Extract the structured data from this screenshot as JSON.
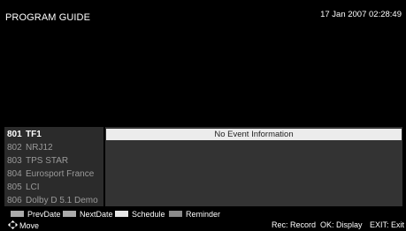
{
  "header": {
    "title": "PROGRAM GUIDE",
    "datetime": "17 Jan 2007 02:28:49"
  },
  "channels": [
    {
      "number": "801",
      "name": "TF1",
      "active": true
    },
    {
      "number": "802",
      "name": "NRJ12",
      "active": false
    },
    {
      "number": "803",
      "name": "TPS STAR",
      "active": false
    },
    {
      "number": "804",
      "name": "Eurosport France",
      "active": false
    },
    {
      "number": "805",
      "name": "LCI",
      "active": false
    },
    {
      "number": "806",
      "name": "Dolby D 5.1 Demo",
      "active": false
    }
  ],
  "event_info": "No Event Information",
  "legend": {
    "prev_date": {
      "label": "PrevDate",
      "color": "#aaaaaa"
    },
    "next_date": {
      "label": "NextDate",
      "color": "#aaaaaa"
    },
    "schedule": {
      "label": "Schedule",
      "color": "#e6e6e6"
    },
    "reminder": {
      "label": "Reminder",
      "color": "#8a8a8a"
    }
  },
  "hints": {
    "move": "Move",
    "move_icon": "arrows-icon",
    "record": "Rec: Record",
    "display": "OK: Display",
    "exit": "EXIT: Exit"
  }
}
